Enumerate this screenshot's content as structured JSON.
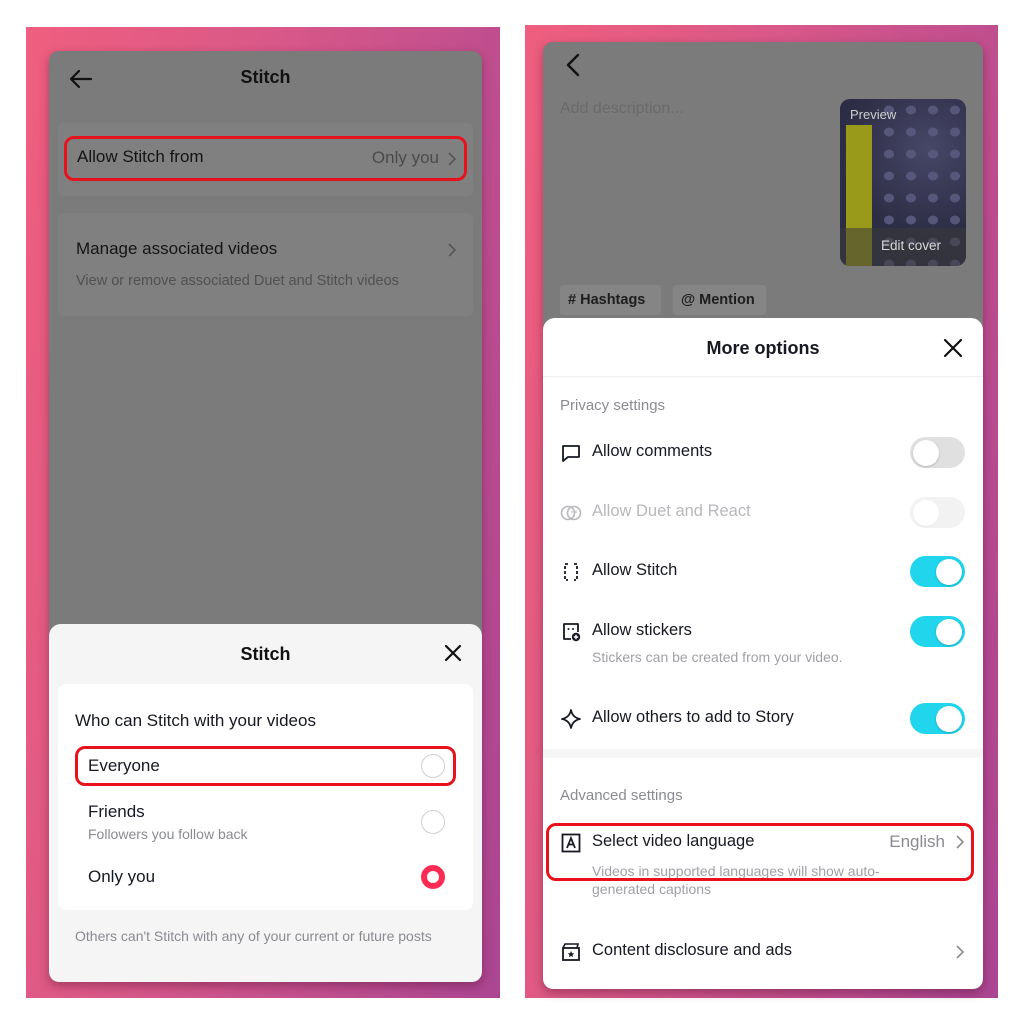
{
  "left_screen": {
    "header": {
      "title": "Stitch",
      "back_icon": "arrow-left-icon"
    },
    "settings": [
      {
        "label": "Allow Stitch from",
        "value": "Only you",
        "highlighted": true
      },
      {
        "label": "Manage associated videos",
        "sub": "View or remove associated Duet and Stitch videos"
      }
    ],
    "sheet": {
      "title": "Stitch",
      "close_icon": "close-icon",
      "question": "Who can Stitch with your videos",
      "options": [
        {
          "label": "Everyone",
          "sub": "",
          "selected": false,
          "highlighted": true
        },
        {
          "label": "Friends",
          "sub": "Followers you follow back",
          "selected": false
        },
        {
          "label": "Only you",
          "sub": "",
          "selected": true
        }
      ],
      "note": "Others can't Stitch with any of your current or future posts"
    }
  },
  "right_screen": {
    "back_icon": "chevron-left-icon",
    "description_placeholder": "Add description...",
    "thumbnail": {
      "preview_label": "Preview",
      "edit_label": "Edit cover"
    },
    "chips": [
      {
        "label": "# Hashtags"
      },
      {
        "label": "@ Mention"
      }
    ],
    "sheet": {
      "title": "More options",
      "privacy_label": "Privacy settings",
      "privacy_items": [
        {
          "label": "Allow comments",
          "icon": "comment-icon",
          "on": false,
          "disabled": false
        },
        {
          "label": "Allow Duet and React",
          "icon": "duet-icon",
          "on": false,
          "disabled": true
        },
        {
          "label": "Allow Stitch",
          "icon": "stitch-icon",
          "on": true,
          "disabled": false,
          "highlighted": true
        },
        {
          "label": "Allow stickers",
          "icon": "sticker-icon",
          "on": true,
          "disabled": false,
          "sub": "Stickers can be created from your video."
        },
        {
          "label": "Allow others to add to Story",
          "icon": "sparkle-icon",
          "on": true,
          "disabled": false
        }
      ],
      "advanced_label": "Advanced settings",
      "advanced_items": [
        {
          "label": "Select video language",
          "icon": "language-icon",
          "value": "English",
          "sub": "Videos in supported languages will show auto-generated captions"
        },
        {
          "label": "Content disclosure and ads",
          "icon": "ad-disclosure-icon"
        }
      ]
    }
  },
  "colors": {
    "toggle_on": "#20d5ec",
    "radio_selected": "#fe2c55",
    "highlight": "#e8121c",
    "dim_overlay": "#7b7b7b"
  }
}
